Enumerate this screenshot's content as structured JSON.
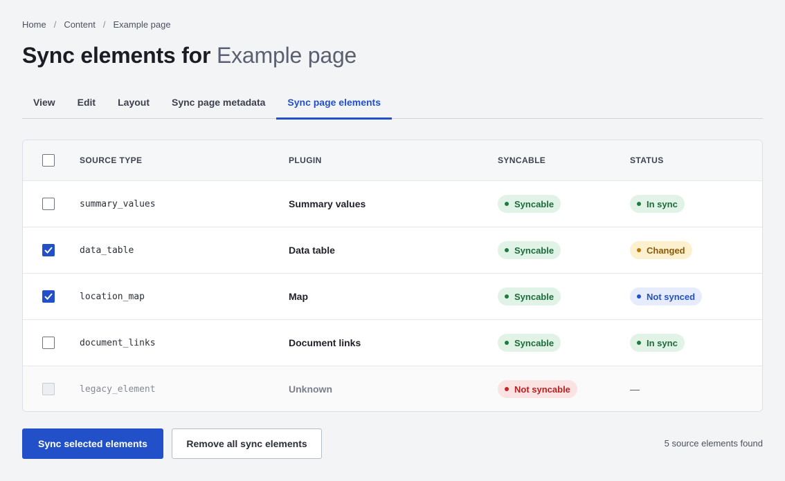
{
  "breadcrumb": [
    "Home",
    "Content",
    "Example page"
  ],
  "breadcrumb_separator": "/",
  "title": {
    "prefix": "Sync elements for",
    "subject": "Example page"
  },
  "tabs": [
    {
      "label": "View",
      "active": false
    },
    {
      "label": "Edit",
      "active": false
    },
    {
      "label": "Layout",
      "active": false
    },
    {
      "label": "Sync page metadata",
      "active": false
    },
    {
      "label": "Sync page elements",
      "active": true
    }
  ],
  "table": {
    "columns": {
      "source_type": "SOURCE TYPE",
      "plugin": "PLUGIN",
      "syncable": "SYNCABLE",
      "status": "STATUS"
    },
    "rows": [
      {
        "checked": false,
        "disabled": false,
        "source_type": "summary_values",
        "plugin": "Summary values",
        "syncable": "Syncable",
        "status": "In sync"
      },
      {
        "checked": true,
        "disabled": false,
        "source_type": "data_table",
        "plugin": "Data table",
        "syncable": "Syncable",
        "status": "Changed"
      },
      {
        "checked": true,
        "disabled": false,
        "source_type": "location_map",
        "plugin": "Map",
        "syncable": "Syncable",
        "status": "Not synced"
      },
      {
        "checked": false,
        "disabled": false,
        "source_type": "document_links",
        "plugin": "Document links",
        "syncable": "Syncable",
        "status": "In sync"
      },
      {
        "checked": false,
        "disabled": true,
        "source_type": "legacy_element",
        "plugin": "Unknown",
        "syncable": "Not syncable",
        "status": "—"
      }
    ]
  },
  "actions": {
    "primary": "Sync selected elements",
    "secondary": "Remove all sync elements"
  },
  "count_text": "5 source elements found",
  "colors": {
    "accent": "#2150c9",
    "green": "#1d7a41",
    "amber": "#b47b0d",
    "red": "#c42424",
    "background": "#f3f4f6"
  }
}
